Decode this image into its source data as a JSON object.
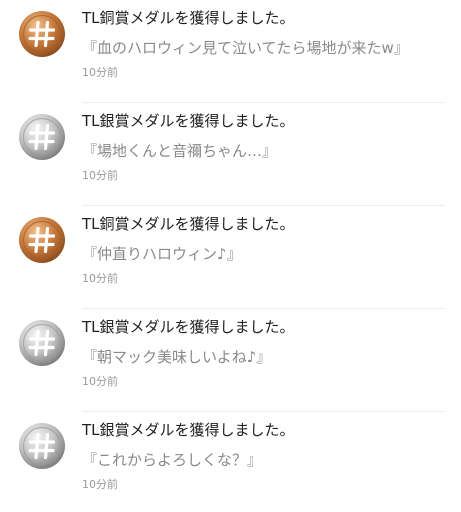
{
  "notifications": [
    {
      "medal": "bronze-medal-icon",
      "title": "TL銅賞メダルを獲得しました。",
      "quote": "『血のハロウィン見て泣いてたら場地が来たw』",
      "time": "10分前"
    },
    {
      "medal": "silver-medal-icon",
      "title": "TL銀賞メダルを獲得しました。",
      "quote": "『場地くんと音禰ちゃん…』",
      "time": "10分前"
    },
    {
      "medal": "bronze-medal-icon",
      "title": "TL銅賞メダルを獲得しました。",
      "quote": "『仲直りハロウィン♪』",
      "time": "10分前"
    },
    {
      "medal": "silver-medal-icon",
      "title": "TL銀賞メダルを獲得しました。",
      "quote": "『朝マック美味しいよね♪』",
      "time": "10分前"
    },
    {
      "medal": "silver-medal-icon",
      "title": "TL銀賞メダルを獲得しました。",
      "quote": "『これからよろしくな？』",
      "time": "10分前"
    }
  ],
  "colors": {
    "bronze_light": "#e3a06a",
    "bronze_mid": "#c77a3c",
    "bronze_dark": "#8f4e1e",
    "silver_light": "#f0f0f0",
    "silver_mid": "#c4c4c4",
    "silver_dark": "#7e7e7e"
  }
}
